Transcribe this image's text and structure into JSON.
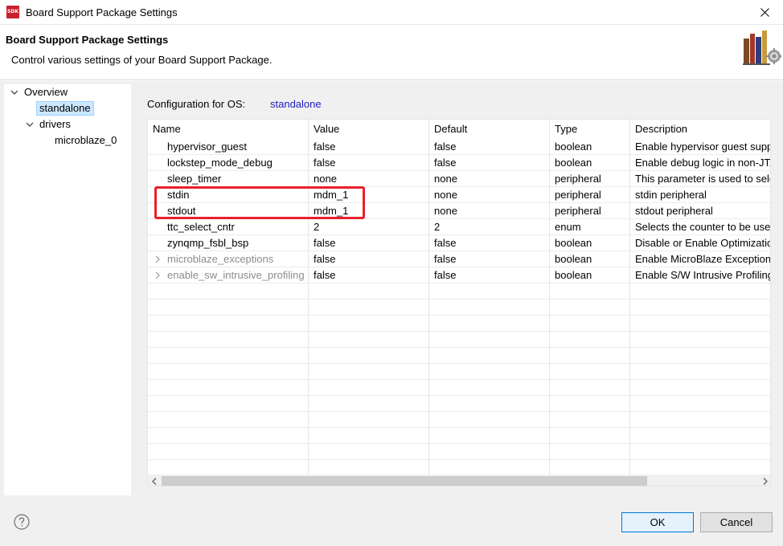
{
  "window": {
    "app_icon_text": "SDK",
    "title": "Board Support Package Settings"
  },
  "header": {
    "title": "Board Support Package Settings",
    "description": "Control various settings of your Board Support Package."
  },
  "tree": {
    "overview": "Overview",
    "standalone": "standalone",
    "drivers": "drivers",
    "microblaze": "microblaze_0"
  },
  "config": {
    "label": "Configuration for OS:",
    "value": "standalone"
  },
  "table": {
    "columns": [
      "Name",
      "Value",
      "Default",
      "Type",
      "Description"
    ],
    "rows": [
      {
        "name": "hypervisor_guest",
        "value": "false",
        "default": "false",
        "type": "boolean",
        "description": "Enable hypervisor guest support"
      },
      {
        "name": "lockstep_mode_debug",
        "value": "false",
        "default": "false",
        "type": "boolean",
        "description": "Enable debug logic in non-JTAG boot mode"
      },
      {
        "name": "sleep_timer",
        "value": "none",
        "default": "none",
        "type": "peripheral",
        "description": "This parameter is used to select specific timer"
      },
      {
        "name": "stdin",
        "value": "mdm_1",
        "default": "none",
        "type": "peripheral",
        "description": "stdin peripheral"
      },
      {
        "name": "stdout",
        "value": "mdm_1",
        "default": "none",
        "type": "peripheral",
        "description": "stdout peripheral"
      },
      {
        "name": "ttc_select_cntr",
        "value": "2",
        "default": "2",
        "type": "enum",
        "description": "Selects the counter to be used"
      },
      {
        "name": "zynqmp_fsbl_bsp",
        "value": "false",
        "default": "false",
        "type": "boolean",
        "description": "Disable or Enable Optimization"
      },
      {
        "name": "microblaze_exceptions",
        "value": "false",
        "default": "false",
        "type": "boolean",
        "description": "Enable MicroBlaze Exceptions"
      },
      {
        "name": "enable_sw_intrusive_profiling",
        "value": "false",
        "default": "false",
        "type": "boolean",
        "description": "Enable S/W Intrusive Profiling"
      }
    ]
  },
  "footer": {
    "ok": "OK",
    "cancel": "Cancel"
  },
  "colors": {
    "highlight": "#e8202a",
    "link": "#1f1fbf",
    "selection": "#cce8ff"
  }
}
